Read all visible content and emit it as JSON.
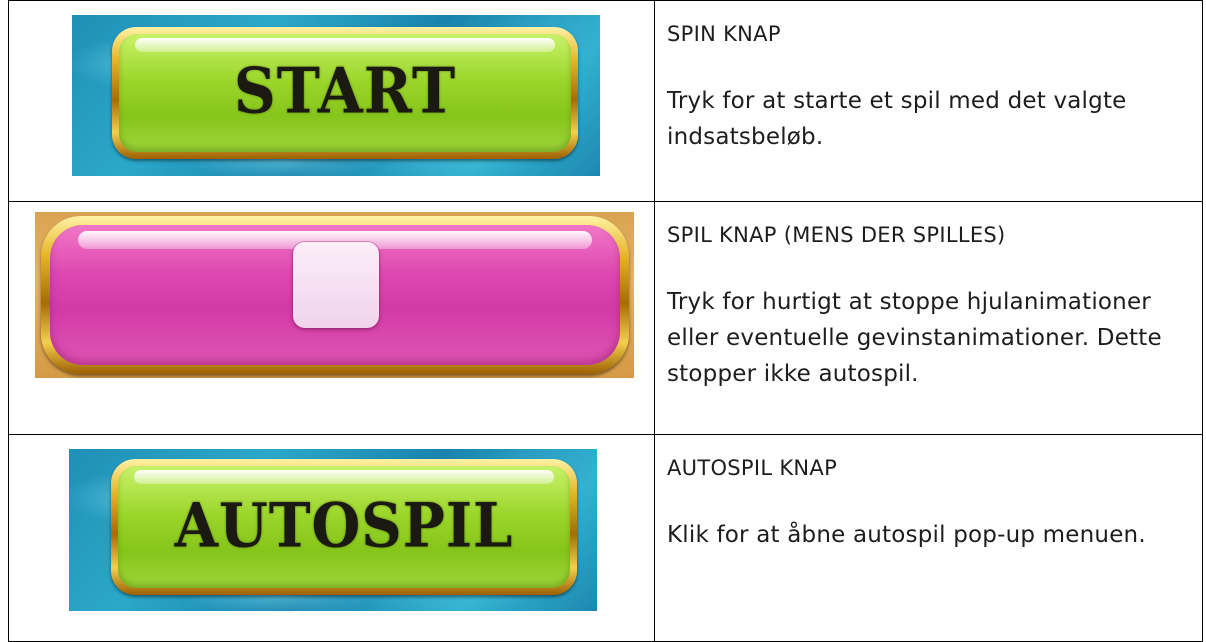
{
  "rows": [
    {
      "button_label": "START",
      "title": "SPIN KNAP",
      "description": "Tryk for at starte et spil med det valgte indsatsbeløb."
    },
    {
      "button_icon": "stop-square-icon",
      "title": "SPIL KNAP (MENS DER SPILLES)",
      "description": "Tryk for hurtigt at stoppe hjulanimationer eller eventuelle gevinstanimationer. Dette stopper ikke autospil."
    },
    {
      "button_label": "AUTOSPIL",
      "title": "AUTOSPIL KNAP",
      "description": "Klik for at åbne autospil pop-up menuen."
    }
  ],
  "colors": {
    "green_button": "#9bd62a",
    "pink_button": "#de47b0",
    "gold_frame": "#e7b526",
    "water": "#2ba8c9",
    "sand": "#e2b463"
  }
}
